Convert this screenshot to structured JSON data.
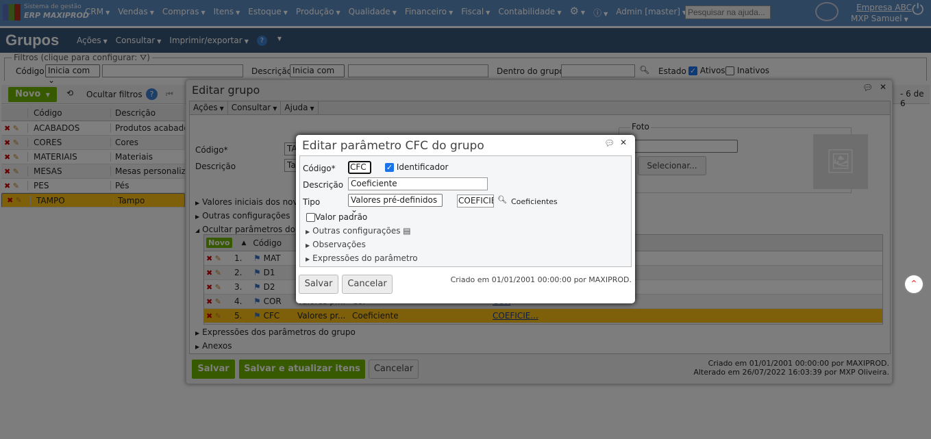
{
  "topbar": {
    "brand_line1": "Sistema de gestão",
    "brand_line2": "ERP MAXIPROD",
    "menus": [
      "CRM",
      "Vendas",
      "Compras",
      "Itens",
      "Estoque",
      "Produção",
      "Qualidade",
      "Financeiro",
      "Fiscal",
      "Contabilidade"
    ],
    "admin": "Admin [master]",
    "search_placeholder": "Pesquisar na ajuda...",
    "company": "Empresa ABC",
    "user": "MXP Samuel"
  },
  "titlebar": {
    "title": "Grupos",
    "menus": [
      "Ações",
      "Consultar",
      "Imprimir/exportar"
    ]
  },
  "filters": {
    "legend": "Filtros (clique para configurar:",
    "legend_end": ")",
    "codigo_label": "Código",
    "codigo_op": "Inicia com",
    "descricao_label": "Descrição",
    "descricao_op": "Inicia com",
    "grupo_label": "Dentro do grupo",
    "estado_label": "Estado",
    "ativos": "Ativos",
    "inativos": "Inativos"
  },
  "toolbar": {
    "novo": "Novo",
    "ocultar": "Ocultar filtros",
    "paging": "- 6 de 6"
  },
  "grid": {
    "headers": [
      "Código",
      "Descrição"
    ],
    "rows": [
      [
        "ACABADOS",
        "Produtos acabados"
      ],
      [
        "CORES",
        "Cores"
      ],
      [
        "MATERIAIS",
        "Materiais"
      ],
      [
        "MESAS",
        "Mesas personalizadas"
      ],
      [
        "PES",
        "Pés"
      ],
      [
        "TAMPO",
        "Tampo"
      ]
    ]
  },
  "edit_group": {
    "title": "Editar grupo",
    "menus": [
      "Ações",
      "Consultar",
      "Ajuda"
    ],
    "codigo_label": "Código*",
    "codigo_value": "TAMPO",
    "descricao_label": "Descrição",
    "descricao_value": "Tampo",
    "foto_legend": "Foto",
    "selecionar": "Selecionar...",
    "sections": [
      "Valores iniciais dos novos itens",
      "Outras configurações",
      "Ocultar parâmetros do grupo"
    ],
    "params_novo": "Novo",
    "params_header": "Código",
    "params": [
      {
        "n": "1.",
        "code": "MAT"
      },
      {
        "n": "2.",
        "code": "D1"
      },
      {
        "n": "3.",
        "code": "D2"
      },
      {
        "n": "4.",
        "code": "COR",
        "tipo": "Valores pr...",
        "desc": "Cor",
        "ref": "COR"
      },
      {
        "n": "5.",
        "code": "CFC",
        "tipo": "Valores pr...",
        "desc": "Coeficiente",
        "ref": "COEFICIE..."
      }
    ],
    "sections_after": [
      "Expressões dos parâmetros do grupo",
      "Anexos"
    ],
    "salvar": "Salvar",
    "salvar_atualizar": "Salvar e atualizar itens",
    "cancelar": "Cancelar",
    "created": "Criado em 01/01/2001 00:00:00 por MAXIPROD.",
    "altered": "Alterado em 26/07/2022 16:03:39 por MXP Oliveira."
  },
  "dialog": {
    "title": "Editar parâmetro CFC do grupo",
    "codigo_label": "Código*",
    "codigo_value": "CFC",
    "identificador": "Identificador",
    "descricao_label": "Descrição",
    "descricao_value": "Coeficiente",
    "tipo_label": "Tipo",
    "tipo_value": "Valores pré-definidos",
    "ref_value": "COEFICIE",
    "ref_desc": "Coeficientes",
    "valor_padrao": "Valor padrão",
    "sections": [
      "Outras configurações",
      "Observações",
      "Expressões do parâmetro"
    ],
    "salvar": "Salvar",
    "cancelar": "Cancelar",
    "created": "Criado em 01/01/2001 00:00:00 por MAXIPROD."
  }
}
